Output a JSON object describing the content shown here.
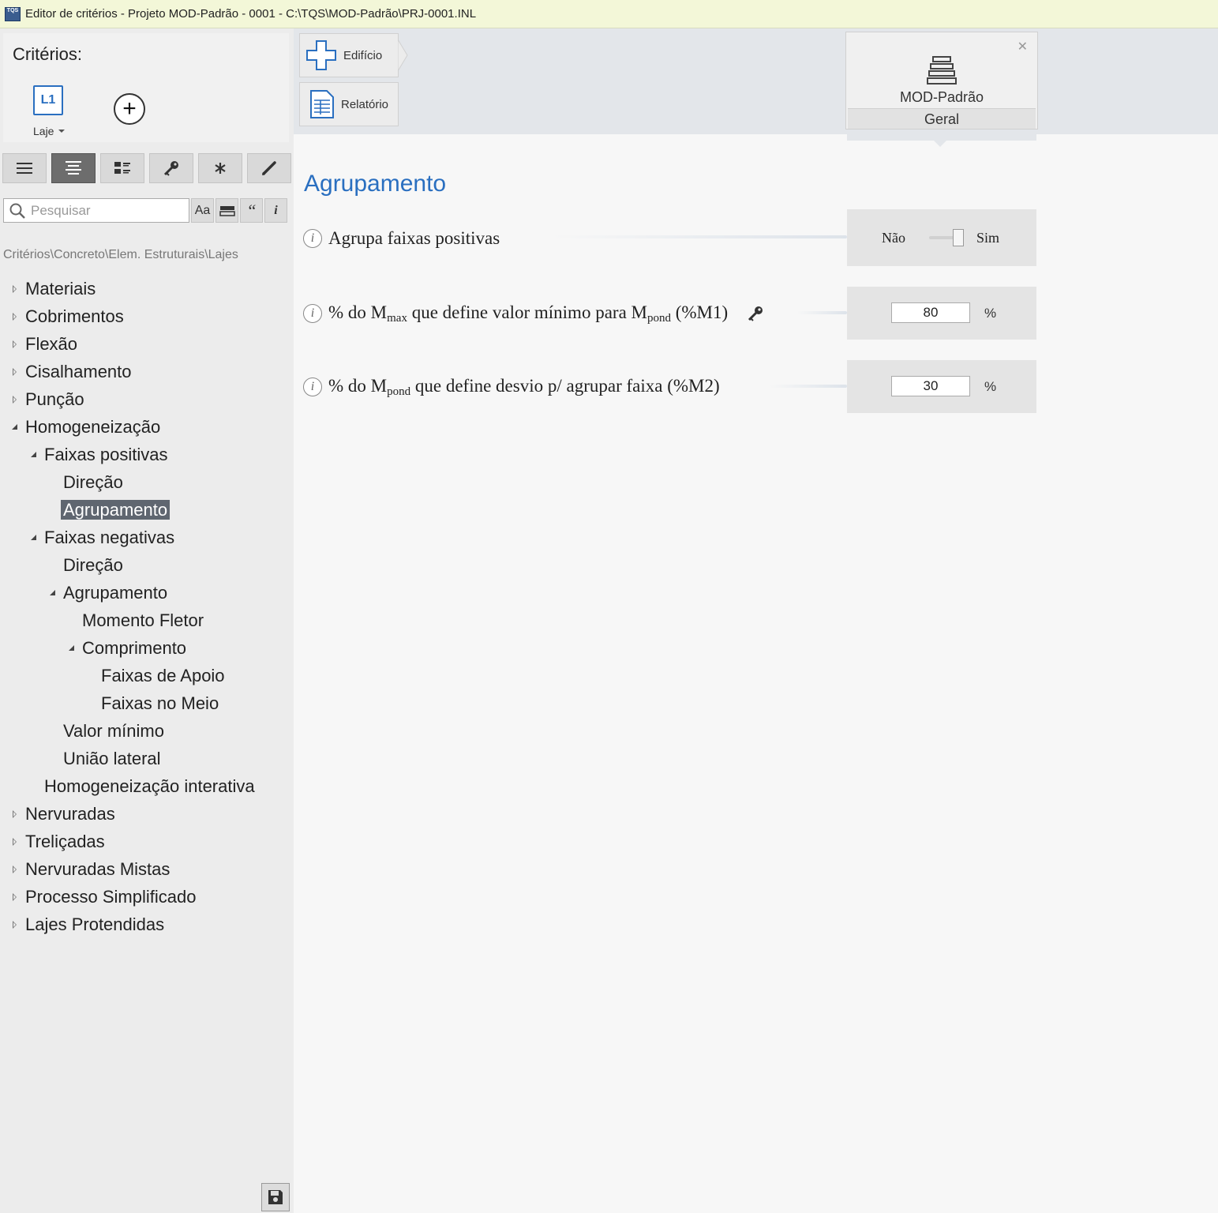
{
  "window": {
    "app_icon_text": "TQS",
    "title": "Editor de critérios - Projeto MOD-Padrão - 0001 - C:\\TQS\\MOD-Padrão\\PRJ-0001.INL"
  },
  "criteria": {
    "title": "Critérios:",
    "element_icon_text": "L1",
    "element_label": "Laje",
    "add_symbol": "+"
  },
  "toolbar": {
    "buttons": [
      "list-icon",
      "list-centered-icon",
      "grid-list-icon",
      "key-icon",
      "asterisk-icon",
      "pen-icon"
    ],
    "active_index": 1
  },
  "search": {
    "placeholder": "Pesquisar",
    "value": "",
    "buttons": [
      "Aa",
      "≡",
      "“",
      "i"
    ]
  },
  "breadcrumb": "Critérios\\Concreto\\Elem. Estruturais\\Lajes",
  "tree": [
    {
      "label": "Materiais",
      "level": 0,
      "state": "closed"
    },
    {
      "label": "Cobrimentos",
      "level": 0,
      "state": "closed"
    },
    {
      "label": "Flexão",
      "level": 0,
      "state": "closed"
    },
    {
      "label": "Cisalhamento",
      "level": 0,
      "state": "closed"
    },
    {
      "label": "Punção",
      "level": 0,
      "state": "closed"
    },
    {
      "label": "Homogeneização",
      "level": 0,
      "state": "open"
    },
    {
      "label": "Faixas positivas",
      "level": 1,
      "state": "open"
    },
    {
      "label": "Direção",
      "level": 2,
      "state": "leaf"
    },
    {
      "label": "Agrupamento",
      "level": 2,
      "state": "leaf",
      "selected": true
    },
    {
      "label": "Faixas negativas",
      "level": 1,
      "state": "open"
    },
    {
      "label": "Direção",
      "level": 2,
      "state": "leaf"
    },
    {
      "label": "Agrupamento",
      "level": 2,
      "state": "open"
    },
    {
      "label": "Momento Fletor",
      "level": 3,
      "state": "leaf"
    },
    {
      "label": "Comprimento",
      "level": 3,
      "state": "open"
    },
    {
      "label": "Faixas de Apoio",
      "level": 4,
      "state": "leaf"
    },
    {
      "label": "Faixas no Meio",
      "level": 4,
      "state": "leaf"
    },
    {
      "label": "Valor mínimo",
      "level": 2,
      "state": "leaf"
    },
    {
      "label": "União lateral",
      "level": 2,
      "state": "leaf"
    },
    {
      "label": "Homogeneização interativa",
      "level": 1,
      "state": "leaf"
    },
    {
      "label": "Nervuradas",
      "level": 0,
      "state": "closed"
    },
    {
      "label": "Treliçadas",
      "level": 0,
      "state": "closed"
    },
    {
      "label": "Nervuradas Mistas",
      "level": 0,
      "state": "closed"
    },
    {
      "label": "Processo Simplificado",
      "level": 0,
      "state": "closed"
    },
    {
      "label": "Lajes Protendidas",
      "level": 0,
      "state": "closed"
    }
  ],
  "nav": {
    "building_label": "Edifício",
    "report_label": "Relatório"
  },
  "model": {
    "name": "MOD-Padrão",
    "tab": "Geral",
    "close_symbol": "✕"
  },
  "section": {
    "title": "Agrupamento",
    "props": [
      {
        "label": "Agrupa faixas positivas",
        "type": "toggle",
        "off_label": "Não",
        "on_label": "Sim",
        "on": true
      },
      {
        "label_parts": [
          "% do M",
          "max",
          " que define valor mínimo para M",
          "pond",
          " (%M1)"
        ],
        "type": "number",
        "value": "80",
        "unit": "%",
        "has_key": true
      },
      {
        "label_parts": [
          "% do M",
          "pond",
          " que define desvio p/ agrupar faixa (%M2)"
        ],
        "type": "number",
        "value": "30",
        "unit": "%"
      }
    ]
  },
  "colors": {
    "accent": "#2a6fc0",
    "selected_bg": "#5f6670",
    "titlebar_bg": "#f3f7d8"
  }
}
